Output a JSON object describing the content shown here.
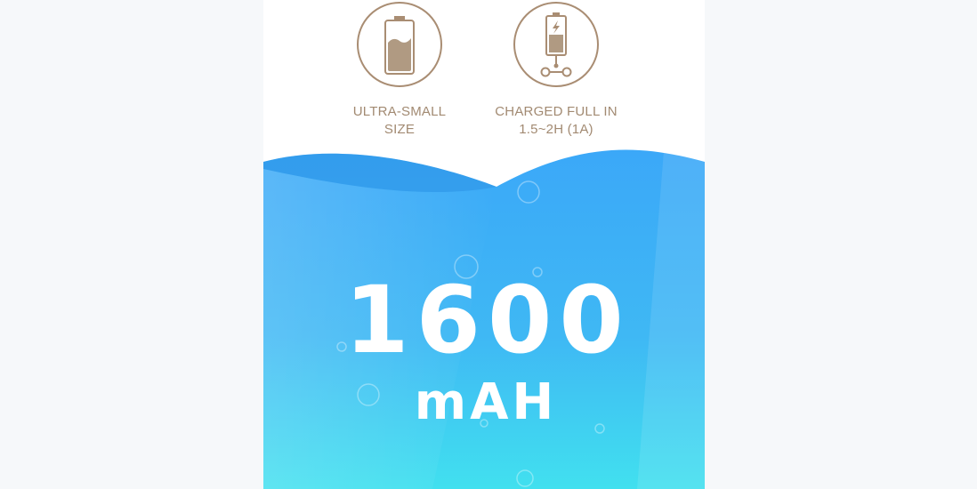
{
  "features": [
    {
      "icon": "battery-icon",
      "line1": "ULTRA-SMALL",
      "line2": "SIZE"
    },
    {
      "icon": "fast-charge-icon",
      "line1": "CHARGED FULL IN",
      "line2": "1.5~2H (1A)"
    }
  ],
  "capacity": {
    "value": "1600",
    "unit": "mAH"
  },
  "colors": {
    "accent": "#a98d73",
    "battery_fill": "#b09a82",
    "water_top": "#3aa6f7",
    "water_bottom": "#41dff0"
  }
}
